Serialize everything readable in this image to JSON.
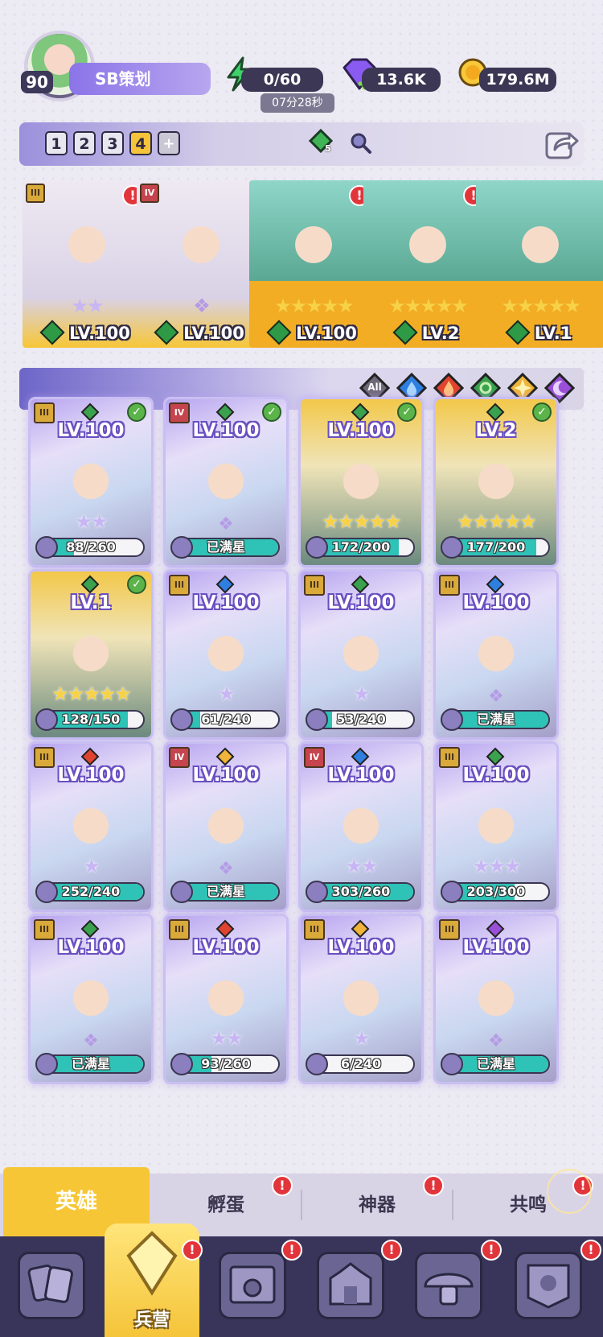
{
  "player": {
    "level": "90",
    "name": "SB策划"
  },
  "resources": {
    "energy": "0/60",
    "energy_timer": "07分28秒",
    "gems": "13.6K",
    "coins": "179.6M"
  },
  "teams": {
    "tabs": [
      "1",
      "2",
      "3",
      "4"
    ],
    "active": "4",
    "add_label": "+",
    "hero_count": "5"
  },
  "team_row": [
    {
      "lv": "LV.100",
      "rank": "III",
      "stars": 2,
      "bg": "#dcd8e6",
      "alert": true
    },
    {
      "lv": "LV.100",
      "rank": "IV",
      "stars": 0,
      "bg": "#dcd8e6",
      "alert": false
    },
    {
      "lv": "LV.100",
      "rank": "",
      "stars": 5,
      "bg": "#f2ad24",
      "alert": true
    },
    {
      "lv": "LV.2",
      "rank": "",
      "stars": 5,
      "bg": "#f2ad24",
      "alert": true
    },
    {
      "lv": "LV.1",
      "rank": "",
      "stars": 5,
      "bg": "#f2ad24",
      "alert": false
    }
  ],
  "filter": {
    "all_label": "All"
  },
  "heroes": [
    {
      "lv": "LV.100",
      "progress": "88/260",
      "pct": 0.34,
      "rank": "III",
      "elem": "#3aa24e",
      "check": true,
      "stars": 2,
      "gold": false
    },
    {
      "lv": "LV.100",
      "progress": "已满星",
      "pct": 1,
      "rank": "IV",
      "elem": "#3aa24e",
      "check": true,
      "stars": 0,
      "gold": false
    },
    {
      "lv": "LV.100",
      "progress": "172/200",
      "pct": 0.86,
      "rank": "",
      "elem": "#3aa24e",
      "check": true,
      "stars": 5,
      "gold": true
    },
    {
      "lv": "LV.2",
      "progress": "177/200",
      "pct": 0.885,
      "rank": "",
      "elem": "#3aa24e",
      "check": true,
      "stars": 5,
      "gold": true
    },
    {
      "lv": "LV.1",
      "progress": "128/150",
      "pct": 0.853,
      "rank": "",
      "elem": "#3aa24e",
      "check": true,
      "stars": 5,
      "gold": true
    },
    {
      "lv": "LV.100",
      "progress": "61/240",
      "pct": 0.254,
      "rank": "III",
      "elem": "#2f7fe0",
      "check": false,
      "stars": 1,
      "gold": false
    },
    {
      "lv": "LV.100",
      "progress": "53/240",
      "pct": 0.22,
      "rank": "III",
      "elem": "#3aa24e",
      "check": false,
      "stars": 1,
      "gold": false
    },
    {
      "lv": "LV.100",
      "progress": "已满星",
      "pct": 1,
      "rank": "III",
      "elem": "#2f7fe0",
      "check": false,
      "stars": 0,
      "gold": false
    },
    {
      "lv": "LV.100",
      "progress": "252/240",
      "pct": 1,
      "rank": "III",
      "elem": "#e0432f",
      "check": false,
      "stars": 1,
      "gold": false
    },
    {
      "lv": "LV.100",
      "progress": "已满星",
      "pct": 1,
      "rank": "IV",
      "elem": "#f0b43a",
      "check": false,
      "stars": 0,
      "gold": false
    },
    {
      "lv": "LV.100",
      "progress": "303/260",
      "pct": 1,
      "rank": "IV",
      "elem": "#2f7fe0",
      "check": false,
      "stars": 2,
      "gold": false
    },
    {
      "lv": "LV.100",
      "progress": "203/300",
      "pct": 0.677,
      "rank": "III",
      "elem": "#3aa24e",
      "check": false,
      "stars": 3,
      "gold": false
    },
    {
      "lv": "LV.100",
      "progress": "已满星",
      "pct": 1,
      "rank": "III",
      "elem": "#3aa24e",
      "check": false,
      "stars": 0,
      "gold": false
    },
    {
      "lv": "LV.100",
      "progress": "93/260",
      "pct": 0.358,
      "rank": "III",
      "elem": "#e0432f",
      "check": false,
      "stars": 2,
      "gold": false
    },
    {
      "lv": "LV.100",
      "progress": "6/240",
      "pct": 0.025,
      "rank": "III",
      "elem": "#f0b43a",
      "check": false,
      "stars": 1,
      "gold": false
    },
    {
      "lv": "LV.100",
      "progress": "已满星",
      "pct": 1,
      "rank": "III",
      "elem": "#9a4fd8",
      "check": false,
      "stars": 0,
      "gold": false
    }
  ],
  "subtabs": {
    "heroes": "英雄",
    "hatch": "孵蛋",
    "artifact": "神器",
    "resonance": "共鸣"
  },
  "nav": {
    "barracks": "兵营",
    "alert_mark": "!"
  },
  "colors": {
    "accent": "#f5c43a",
    "nav_bg": "#39355a",
    "purple": "#8b74e8"
  }
}
